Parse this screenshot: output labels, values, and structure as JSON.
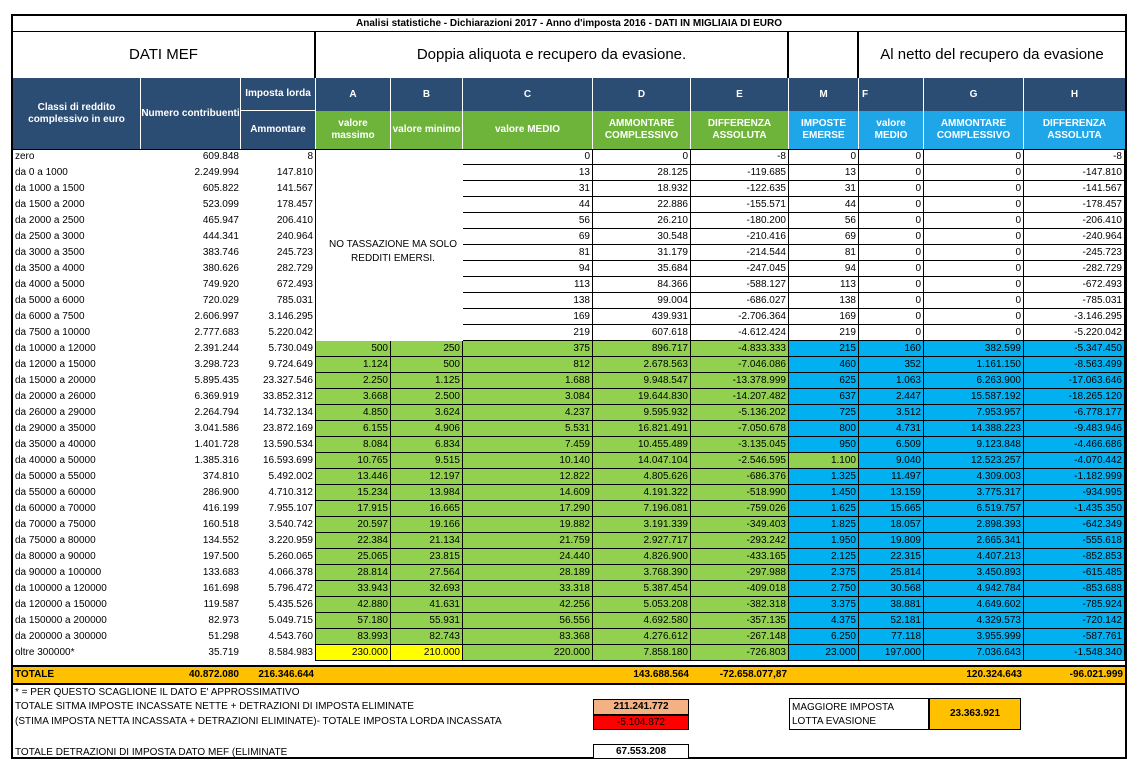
{
  "title": "Analisi statistiche - Dichiarazioni 2017 - Anno d'imposta 2016 - DATI IN MIGLIAIA DI EURO",
  "bands": {
    "mef": "DATI MEF",
    "doppia": "Doppia aliquota e recupero da evasione.",
    "netto": "Al netto del recupero da evasione"
  },
  "headers": {
    "classi": "Classi di reddito complessivo in euro",
    "numero": "Numero contribuenti",
    "imposta": "Imposta lorda",
    "ammontare": "Ammontare",
    "A": "A",
    "B": "B",
    "C": "C",
    "D": "D",
    "E": "E",
    "M": "M",
    "F": "F",
    "G": "G",
    "H": "H",
    "a_sub": "valore massimo",
    "b_sub": "valore minimo",
    "c_sub": "valore MEDIO",
    "d_sub": "AMMONTARE COMPLESSIVO",
    "e_sub": "DIFFERENZA ASSOLUTA",
    "m_sub": "IMPOSTE EMERSE",
    "f_sub": "valore MEDIO",
    "g_sub": "AMMONTARE COMPLESSIVO",
    "h_sub": "DIFFERENZA ASSOLUTA"
  },
  "no_tax_note": "NO TASSAZIONE MA SOLO REDDITI EMERSI.",
  "rows": [
    [
      "zero",
      "609.848",
      "8",
      "",
      "",
      "0",
      "0",
      "-8",
      "0",
      "0",
      "0",
      "-8"
    ],
    [
      "da 0 a 1000",
      "2.249.994",
      "147.810",
      "",
      "",
      "13",
      "28.125",
      "-119.685",
      "13",
      "0",
      "0",
      "-147.810"
    ],
    [
      "da 1000 a 1500",
      "605.822",
      "141.567",
      "",
      "",
      "31",
      "18.932",
      "-122.635",
      "31",
      "0",
      "0",
      "-141.567"
    ],
    [
      "da 1500 a 2000",
      "523.099",
      "178.457",
      "",
      "",
      "44",
      "22.886",
      "-155.571",
      "44",
      "0",
      "0",
      "-178.457"
    ],
    [
      "da 2000 a 2500",
      "465.947",
      "206.410",
      "",
      "",
      "56",
      "26.210",
      "-180.200",
      "56",
      "0",
      "0",
      "-206.410"
    ],
    [
      "da 2500 a 3000",
      "444.341",
      "240.964",
      "",
      "",
      "69",
      "30.548",
      "-210.416",
      "69",
      "0",
      "0",
      "-240.964"
    ],
    [
      "da 3000 a 3500",
      "383.746",
      "245.723",
      "",
      "",
      "81",
      "31.179",
      "-214.544",
      "81",
      "0",
      "0",
      "-245.723"
    ],
    [
      "da 3500 a 4000",
      "380.626",
      "282.729",
      "",
      "",
      "94",
      "35.684",
      "-247.045",
      "94",
      "0",
      "0",
      "-282.729"
    ],
    [
      "da 4000 a 5000",
      "749.920",
      "672.493",
      "",
      "",
      "113",
      "84.366",
      "-588.127",
      "113",
      "0",
      "0",
      "-672.493"
    ],
    [
      "da 5000 a 6000",
      "720.029",
      "785.031",
      "",
      "",
      "138",
      "99.004",
      "-686.027",
      "138",
      "0",
      "0",
      "-785.031"
    ],
    [
      "da 6000 a 7500",
      "2.606.997",
      "3.146.295",
      "",
      "",
      "169",
      "439.931",
      "-2.706.364",
      "169",
      "0",
      "0",
      "-3.146.295"
    ],
    [
      "da 7500 a 10000",
      "2.777.683",
      "5.220.042",
      "",
      "",
      "219",
      "607.618",
      "-4.612.424",
      "219",
      "0",
      "0",
      "-5.220.042"
    ],
    [
      "da 10000 a 12000",
      "2.391.244",
      "5.730.049",
      "500",
      "250",
      "375",
      "896.717",
      "-4.833.333",
      "215",
      "160",
      "382.599",
      "-5.347.450"
    ],
    [
      "da 12000 a 15000",
      "3.298.723",
      "9.724.649",
      "1.124",
      "500",
      "812",
      "2.678.563",
      "-7.046.086",
      "460",
      "352",
      "1.161.150",
      "-8.563.499"
    ],
    [
      "da 15000 a 20000",
      "5.895.435",
      "23.327.546",
      "2.250",
      "1.125",
      "1.688",
      "9.948.547",
      "-13.378.999",
      "625",
      "1.063",
      "6.263.900",
      "-17.063.646"
    ],
    [
      "da 20000 a 26000",
      "6.369.919",
      "33.852.312",
      "3.668",
      "2.500",
      "3.084",
      "19.644.830",
      "-14.207.482",
      "637",
      "2.447",
      "15.587.192",
      "-18.265.120"
    ],
    [
      "da 26000 a 29000",
      "2.264.794",
      "14.732.134",
      "4.850",
      "3.624",
      "4.237",
      "9.595.932",
      "-5.136.202",
      "725",
      "3.512",
      "7.953.957",
      "-6.778.177"
    ],
    [
      "da 29000 a 35000",
      "3.041.586",
      "23.872.169",
      "6.155",
      "4.906",
      "5.531",
      "16.821.491",
      "-7.050.678",
      "800",
      "4.731",
      "14.388.223",
      "-9.483.946"
    ],
    [
      "da 35000 a 40000",
      "1.401.728",
      "13.590.534",
      "8.084",
      "6.834",
      "7.459",
      "10.455.489",
      "-3.135.045",
      "950",
      "6.509",
      "9.123.848",
      "-4.466.686"
    ],
    [
      "da 40000 a 50000",
      "1.385.316",
      "16.593.699",
      "10.765",
      "9.515",
      "10.140",
      "14.047.104",
      "-2.546.595",
      "1.100",
      "9.040",
      "12.523.257",
      "-4.070.442"
    ],
    [
      "da 50000 a 55000",
      "374.810",
      "5.492.002",
      "13.446",
      "12.197",
      "12.822",
      "4.805.626",
      "-686.376",
      "1.325",
      "11.497",
      "4.309.003",
      "-1.182.999"
    ],
    [
      "da 55000 a 60000",
      "286.900",
      "4.710.312",
      "15.234",
      "13.984",
      "14.609",
      "4.191.322",
      "-518.990",
      "1.450",
      "13.159",
      "3.775.317",
      "-934.995"
    ],
    [
      "da 60000 a 70000",
      "416.199",
      "7.955.107",
      "17.915",
      "16.665",
      "17.290",
      "7.196.081",
      "-759.026",
      "1.625",
      "15.665",
      "6.519.757",
      "-1.435.350"
    ],
    [
      "da 70000 a 75000",
      "160.518",
      "3.540.742",
      "20.597",
      "19.166",
      "19.882",
      "3.191.339",
      "-349.403",
      "1.825",
      "18.057",
      "2.898.393",
      "-642.349"
    ],
    [
      "da 75000 a 80000",
      "134.552",
      "3.220.959",
      "22.384",
      "21.134",
      "21.759",
      "2.927.717",
      "-293.242",
      "1.950",
      "19.809",
      "2.665.341",
      "-555.618"
    ],
    [
      "da 80000 a 90000",
      "197.500",
      "5.260.065",
      "25.065",
      "23.815",
      "24.440",
      "4.826.900",
      "-433.165",
      "2.125",
      "22.315",
      "4.407.213",
      "-852.853"
    ],
    [
      "da 90000 a 100000",
      "133.683",
      "4.066.378",
      "28.814",
      "27.564",
      "28.189",
      "3.768.390",
      "-297.988",
      "2.375",
      "25.814",
      "3.450.893",
      "-615.485"
    ],
    [
      "da 100000 a 120000",
      "161.698",
      "5.796.472",
      "33.943",
      "32.693",
      "33.318",
      "5.387.454",
      "-409.018",
      "2.750",
      "30.568",
      "4.942.784",
      "-853.688"
    ],
    [
      "da 120000 a 150000",
      "119.587",
      "5.435.526",
      "42.880",
      "41.631",
      "42.256",
      "5.053.208",
      "-382.318",
      "3.375",
      "38.881",
      "4.649.602",
      "-785.924"
    ],
    [
      "da 150000 a 200000",
      "82.973",
      "5.049.715",
      "57.180",
      "55.931",
      "56.556",
      "4.692.580",
      "-357.135",
      "4.375",
      "52.181",
      "4.329.573",
      "-720.142"
    ],
    [
      "da 200000 a 300000",
      "51.298",
      "4.543.760",
      "83.993",
      "82.743",
      "83.368",
      "4.276.612",
      "-267.148",
      "6.250",
      "77.118",
      "3.955.999",
      "-587.761"
    ],
    [
      "oltre 300000*",
      "35.719",
      "8.584.983",
      "230.000",
      "210.000",
      "220.000",
      "7.858.180",
      "-726.803",
      "23.000",
      "197.000",
      "7.036.643",
      "-1.548.340"
    ]
  ],
  "totals": {
    "label": "TOTALE",
    "numero": "40.872.080",
    "imposta": "216.346.644",
    "d": "143.688.564",
    "e": "-72.658.077,87",
    "g": "120.324.643",
    "h": "-96.021.999"
  },
  "footer": {
    "note": "* = PER QUESTO SCAGLIONE IL DATO E' APPROSSIMATIVO",
    "line1": "TOTALE SITMA IMPOSTE INCASSATE NETTE  + DETRAZIONI DI IMPOSTA ELIMINATE",
    "line1_value": "211.241.772",
    "line2": "(STIMA IMPOSTA NETTA INCASSATA + DETRAZIONI ELIMINATE)- TOTALE IMPOSTA LORDA INCASSATA",
    "line2_value": "-5.104.872",
    "line3": "TOTALE DETRAZIONI DI IMPOSTA DATO MEF (ELIMINATE",
    "line3_value": "67.553.208",
    "maggiore_1": "MAGGIORE IMPOSTA",
    "maggiore_2": "LOTTA EVASIONE",
    "maggiore_value": "23.363.921"
  },
  "colors": {
    "header_dark": "#2b4c73",
    "header_green": "#6fb43a",
    "header_blue": "#1ea6e8",
    "cell_green": "#92d050",
    "cell_blue": "#00b0f0",
    "total_orange": "#ffc000",
    "highlight_yellow": "#ffff00",
    "negative_red": "#ff0000"
  }
}
